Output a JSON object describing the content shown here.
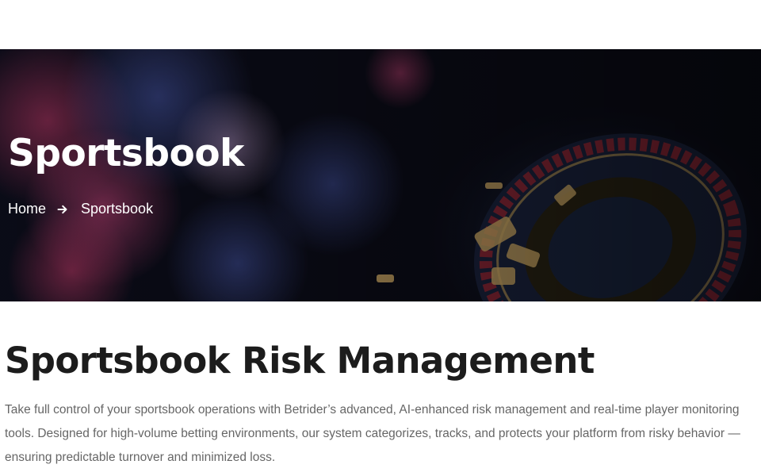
{
  "hero": {
    "title": "Sportsbook",
    "breadcrumb": {
      "home": "Home",
      "current": "Sportsbook"
    }
  },
  "section": {
    "title": "Sportsbook Risk Management",
    "text": "Take full control of your sportsbook operations with Betrider’s advanced, AI-enhanced risk management and real-time player monitoring tools. Designed for high-volume betting environments, our system categorizes, tracks, and protects your platform from risky behavior — ensuring predictable turnover and minimized loss."
  },
  "icons": {
    "breadcrumb_separator": "arrow-right-icon"
  }
}
